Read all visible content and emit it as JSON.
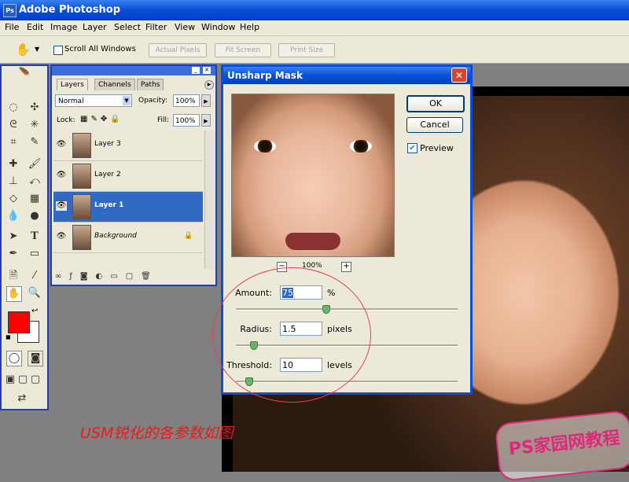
{
  "app": {
    "title": "Adobe Photoshop",
    "logo_text": "Ps"
  },
  "menu": [
    "File",
    "Edit",
    "Image",
    "Layer",
    "Select",
    "Filter",
    "View",
    "Window",
    "Help"
  ],
  "options_bar": {
    "scroll_all_label": "Scroll All Windows",
    "scroll_all_checked": false,
    "actual_pixels": "Actual Pixels",
    "fit_screen": "Fit Screen",
    "print_size": "Print Size"
  },
  "layers_panel": {
    "tabs": [
      "Layers",
      "Channels",
      "Paths"
    ],
    "blend_mode": "Normal",
    "opacity_label": "Opacity:",
    "opacity_value": "100%",
    "lock_label": "Lock:",
    "fill_label": "Fill:",
    "fill_value": "100%",
    "layers": [
      {
        "name": "Layer 3",
        "selected": false
      },
      {
        "name": "Layer 2",
        "selected": false
      },
      {
        "name": "Layer 1",
        "selected": true
      },
      {
        "name": "Background",
        "selected": false,
        "locked": true
      }
    ]
  },
  "dialog": {
    "title": "Unsharp Mask",
    "ok": "OK",
    "cancel": "Cancel",
    "preview_label": "Preview",
    "preview_checked": true,
    "zoom_value": "100%",
    "zoom_out": "−",
    "zoom_in": "+",
    "amount": {
      "label": "Amount:",
      "value": "75",
      "unit": "%"
    },
    "radius": {
      "label": "Radius:",
      "value": "1.5",
      "unit": "pixels"
    },
    "threshold": {
      "label": "Threshold:",
      "value": "10",
      "unit": "levels"
    },
    "slider_levels": {
      "amount": 0.38,
      "radius": 0.08,
      "threshold": 0.04
    }
  },
  "colors": {
    "foreground": "#ff0000",
    "background": "#ffffff",
    "title_blue": "#0a50d8"
  },
  "annotation": {
    "caption": "USM锐化的各参数如图",
    "watermark": "PS家园网教程"
  }
}
